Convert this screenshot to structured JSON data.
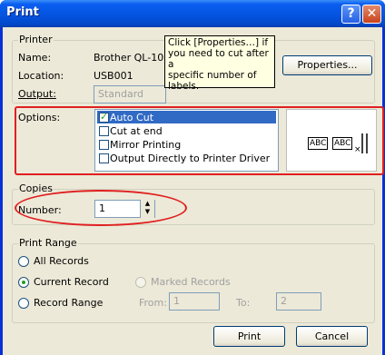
{
  "window": {
    "title": "Print"
  },
  "printer": {
    "group_label": "Printer",
    "name_label": "Name:",
    "name_value": "Brother QL-1050",
    "location_label": "Location:",
    "location_value": "USB001",
    "output_label": "Output:",
    "output_value": "Standard",
    "properties_button": "Properties..."
  },
  "tooltip": {
    "text": "Click [Properties…] if\nyou need to cut after a\nspecific number of\nlabels."
  },
  "options": {
    "label": "Options:",
    "items": [
      {
        "label": "Auto Cut",
        "checked": true,
        "selected": true
      },
      {
        "label": "Cut at end",
        "checked": false,
        "selected": false
      },
      {
        "label": "Mirror Printing",
        "checked": false,
        "selected": false
      },
      {
        "label": "Output Directly to Printer Driver",
        "checked": false,
        "selected": false
      }
    ],
    "preview": {
      "label1": "ABC",
      "label2": "ABC"
    }
  },
  "copies": {
    "group_label": "Copies",
    "number_label": "Number:",
    "number_value": "1"
  },
  "print_range": {
    "group_label": "Print Range",
    "all_records": "All Records",
    "current_record": "Current Record",
    "marked_records": "Marked Records",
    "record_range": "Record Range",
    "from_label": "From:",
    "from_value": "1",
    "to_label": "To:",
    "to_value": "2",
    "selected": "current_record"
  },
  "buttons": {
    "print": "Print",
    "cancel": "Cancel"
  },
  "colors": {
    "titlebar": "#0454e0",
    "dialog_bg": "#ece9d8",
    "selection": "#316ac5",
    "annotation_red": "#e02020",
    "tooltip_bg": "#ffffe1"
  }
}
